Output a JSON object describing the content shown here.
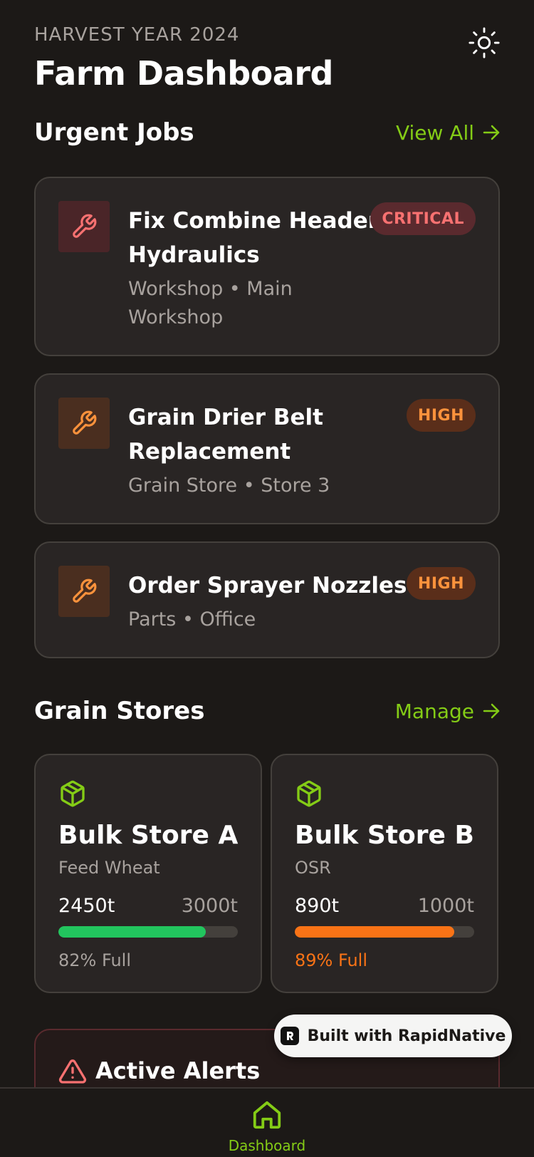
{
  "header": {
    "eyebrow": "HARVEST YEAR 2024",
    "title": "Farm Dashboard",
    "theme_icon": "sun-icon"
  },
  "urgent_jobs": {
    "title": "Urgent Jobs",
    "link_label": "View All",
    "items": [
      {
        "title_line1": "Fix Combine Header",
        "title_line2": "Hydraulics",
        "meta_line1": "Workshop • Main",
        "meta_line2": "Workshop",
        "badge": "CRITICAL",
        "icon": "wrench-icon"
      },
      {
        "title_line1": "Grain Drier Belt",
        "title_line2": "Replacement",
        "meta_line1": "Grain Store • Store 3",
        "badge": "HIGH",
        "icon": "wrench-icon"
      },
      {
        "title_line1": "Order Sprayer Nozzles",
        "meta_line1": "Parts • Office",
        "badge": "HIGH",
        "icon": "wrench-icon"
      }
    ]
  },
  "grain_stores": {
    "title": "Grain Stores",
    "link_label": "Manage",
    "items": [
      {
        "name": "Bulk Store A",
        "crop": "Feed Wheat",
        "current": "2450t",
        "capacity": "3000t",
        "fill_fraction": 0.82,
        "pct_label": "82% Full",
        "bar_color": "#22c55e",
        "pct_color": "#a8a29e"
      },
      {
        "name": "Bulk Store B",
        "crop": "OSR",
        "current": "890t",
        "capacity": "1000t",
        "fill_fraction": 0.89,
        "pct_label": "89% Full",
        "bar_color": "#f97316",
        "pct_color": "#f97316"
      }
    ]
  },
  "alerts": {
    "title": "Active Alerts",
    "icon": "warning-triangle-icon"
  },
  "built_with": {
    "label": "Built with RapidNative"
  },
  "tabbar": {
    "tabs": [
      {
        "label": "Dashboard",
        "icon": "home-icon",
        "active": true
      }
    ]
  },
  "colors": {
    "accent": "#84cc16",
    "critical": "#f87171",
    "high": "#fb923c",
    "background": "#1c1917",
    "card": "#292524"
  }
}
